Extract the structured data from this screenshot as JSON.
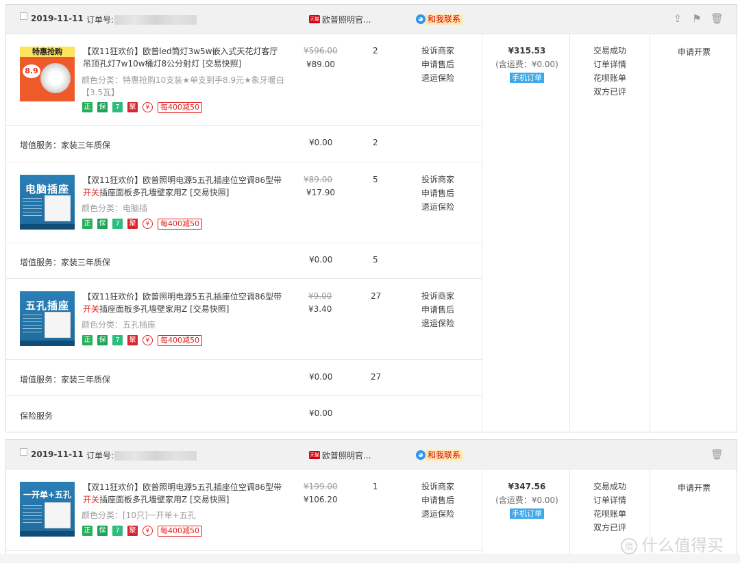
{
  "orders": [
    {
      "date": "2019-11-11",
      "order_no_label": "订单号:",
      "tmall_badge": "天猫",
      "shop": "欧普照明官...",
      "contact": "和我联系",
      "items": [
        {
          "thumb": "特惠抢购",
          "thumb_price": "8.9",
          "title_prefix": "【双11狂欢价】欧普led筒灯3w5w嵌入式天花灯客厅吊顶孔灯7w10w桶灯8公分射灯",
          "title_red": "",
          "title_rest": "",
          "snapshot": "[交易快照]",
          "sku": "颜色分类：特惠抢购10支装★单支到手8.9元★象牙暖白【3.5瓦】",
          "original_price": "¥596.00",
          "price": "¥89.00",
          "qty": "2",
          "actions": [
            "投诉商家",
            "申请售后",
            "退运保险"
          ],
          "service": {
            "label": "增值服务：家装三年质保",
            "price": "¥0.00",
            "qty": "2"
          }
        },
        {
          "thumb": "电脑插座",
          "title_prefix": "【双11狂欢价】欧普照明电源5五孔插座位空调86型带",
          "title_red": "开关",
          "title_rest": "插座面板多孔墙壁家用Z",
          "snapshot": "[交易快照]",
          "sku": "颜色分类：电脑插",
          "original_price": "¥89.00",
          "price": "¥17.90",
          "qty": "5",
          "actions": [
            "投诉商家",
            "申请售后",
            "退运保险"
          ],
          "service": {
            "label": "增值服务：家装三年质保",
            "price": "¥0.00",
            "qty": "5"
          }
        },
        {
          "thumb": "五孔插座",
          "title_prefix": "【双11狂欢价】欧普照明电源5五孔插座位空调86型带",
          "title_red": "开关",
          "title_rest": "插座面板多孔墙壁家用Z",
          "snapshot": "[交易快照]",
          "sku": "颜色分类：五孔插座",
          "original_price": "¥9.00",
          "price": "¥3.40",
          "qty": "27",
          "actions": [
            "投诉商家",
            "申请售后",
            "退运保险"
          ],
          "service": {
            "label": "增值服务：家装三年质保",
            "price": "¥0.00",
            "qty": "27"
          }
        }
      ],
      "insurance": {
        "label": "保险服务",
        "price": "¥0.00"
      },
      "total": "¥315.53",
      "shipping": "(含运费：¥0.00)",
      "mobile_order": "手机订单",
      "status": [
        "交易成功",
        "订单详情",
        "花呗账单",
        "双方已评"
      ],
      "invoice": "申请开票"
    },
    {
      "date": "2019-11-11",
      "order_no_label": "订单号:",
      "tmall_badge": "天猫",
      "shop": "欧普照明官...",
      "contact": "和我联系",
      "items": [
        {
          "thumb": "一开单+五孔",
          "title_prefix": "【双11狂欢价】欧普照明电源5五孔插座位空调86型带",
          "title_red": "开关",
          "title_rest": "插座面板多孔墙壁家用Z",
          "snapshot": "[交易快照]",
          "sku": "颜色分类：[10只]一开单+五孔",
          "original_price": "¥199.00",
          "price": "¥106.20",
          "qty": "1",
          "actions": [
            "投诉商家",
            "申请售后",
            "退运保险"
          ]
        }
      ],
      "total": "¥347.56",
      "shipping": "(含运费：¥0.00)",
      "mobile_order": "手机订单",
      "status": [
        "交易成功",
        "订单详情",
        "花呗账单",
        "双方已评"
      ],
      "invoice": "申请开票"
    }
  ],
  "badges": {
    "zheng": "正",
    "bao": "保",
    "seven": "7",
    "ju": "聚",
    "yuan": "¥",
    "promo": "每400减50"
  },
  "icons": [
    "share-icon",
    "flag-icon",
    "trash-icon",
    "wangwang-icon"
  ],
  "watermark": "什么值得买",
  "watermark_icon": "值",
  "colors": {
    "accent_red": "#e5211e",
    "mobile_blue": "#3fa8e8",
    "header_bg": "#f1f1f1"
  }
}
